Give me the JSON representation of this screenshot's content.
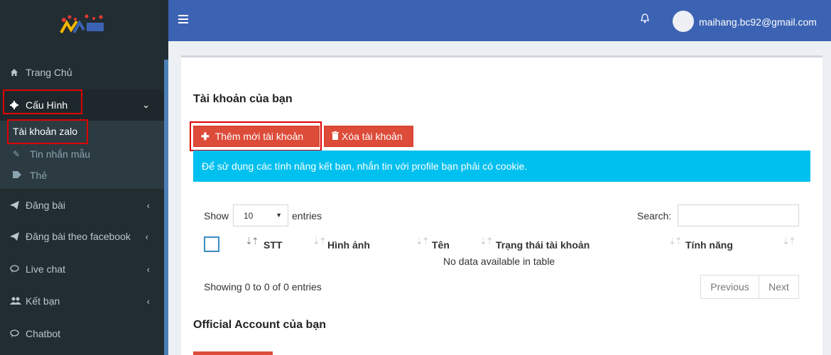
{
  "header": {
    "user_email": "maihang.bc92@gmail.com"
  },
  "sidebar": {
    "items": [
      {
        "label": "Trang Chủ",
        "icon": "home-icon"
      },
      {
        "label": "Cấu Hình",
        "icon": "gear-icon"
      },
      {
        "label": "Đăng bài",
        "icon": "paper-plane-icon"
      },
      {
        "label": "Đăng bài theo facebook",
        "icon": "paper-plane-icon"
      },
      {
        "label": "Live chat",
        "icon": "chat-bubble-icon"
      },
      {
        "label": "Kết bạn",
        "icon": "users-icon"
      },
      {
        "label": "Chatbot",
        "icon": "chat-bubble-icon"
      }
    ],
    "sub_items": [
      {
        "label": "Tài khoản zalo"
      },
      {
        "label": "Tin nhắn mẫu",
        "icon": "paperclip-icon"
      },
      {
        "label": "Thẻ",
        "icon": "tag-icon"
      }
    ]
  },
  "content": {
    "title": "Tài khoản của bạn",
    "add_button": "Thêm mới tài khoản",
    "delete_button": "Xóa tài khoản",
    "alert": "Để sử dụng các tính năng kết bạn, nhắn tin với profile bạn phải có cookie.",
    "show_label": "Show",
    "page_length": "10",
    "entries_label": "entries",
    "search_label": "Search:",
    "columns": [
      "STT",
      "Hình ảnh",
      "Tên",
      "Trạng thái tài khoản",
      "Tính năng"
    ],
    "empty_text": "No data available in table",
    "info": "Showing 0 to 0 of 0 entries",
    "prev": "Previous",
    "next": "Next",
    "oa_title": "Official Account của bạn"
  },
  "colors": {
    "header": "#3c63b3",
    "sidebar": "#222d32",
    "danger": "#dd4b39",
    "info": "#00c0ef",
    "highlight": "#e00000"
  }
}
